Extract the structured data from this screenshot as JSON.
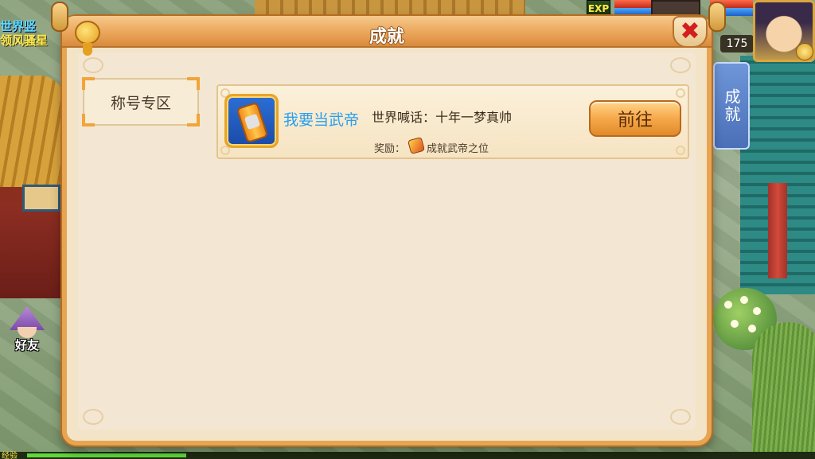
{
  "hud": {
    "top_left_line1": "世界竖",
    "top_left_line2": "领风骚星",
    "exp_badge": "EXP",
    "level": "175",
    "side_tab": "成就",
    "friend_label": "好友",
    "exp_strip_label": "经验"
  },
  "dialog": {
    "title": "成就",
    "close_symbol": "✖"
  },
  "category": {
    "label": "称号专区"
  },
  "achievements": [
    {
      "name": "我要当武帝",
      "description": "世界喊话：十年一梦真帅",
      "reward_label": "奖励：",
      "reward_item": "成就武帝之位",
      "go_label": "前往",
      "icon": "scroll-title-icon"
    }
  ],
  "colors": {
    "frame": "#e7a552",
    "panel": "#f3e4c8",
    "name_blue": "#2aa0f0",
    "close_red": "#d21e1e"
  }
}
